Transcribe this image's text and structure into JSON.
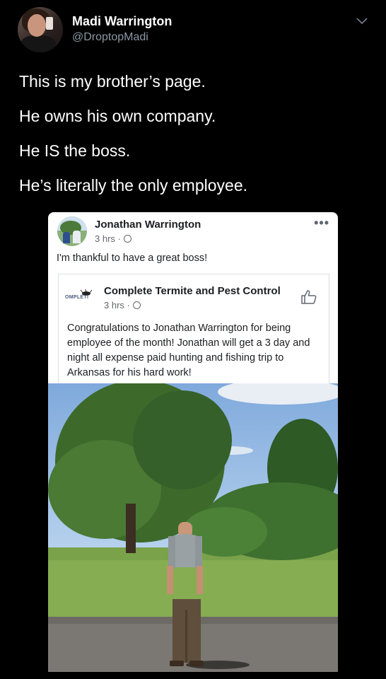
{
  "tweet": {
    "author_name": "Madi Warrington",
    "author_handle": "@DroptopMadi",
    "lines": [
      "This is my brother’s page.",
      "He owns his own company.",
      "He IS the boss.",
      "He’s literally the only employee."
    ]
  },
  "facebook_post": {
    "poster_name": "Jonathan Warrington",
    "poster_time": "3 hrs ·",
    "caption": "I'm thankful to have a great boss!",
    "shared": {
      "page_name": "Complete Termite and Pest Control",
      "page_time": "3 hrs ·",
      "logo_text": "OMPLETI",
      "body": "Congratulations to Jonathan Warrington for being employee of the month! Jonathan will get a 3 day and night all expense paid hunting and fishing trip to Arkansas for his hard work!"
    }
  },
  "icons": {
    "chevron": "chevron-down-icon",
    "more": "more-options-icon",
    "globe": "globe-icon",
    "like": "like-icon"
  },
  "colors": {
    "background": "#000000",
    "handle_gray": "#8b98a5",
    "fb_text": "#1c1e21",
    "fb_meta": "#65676b"
  }
}
